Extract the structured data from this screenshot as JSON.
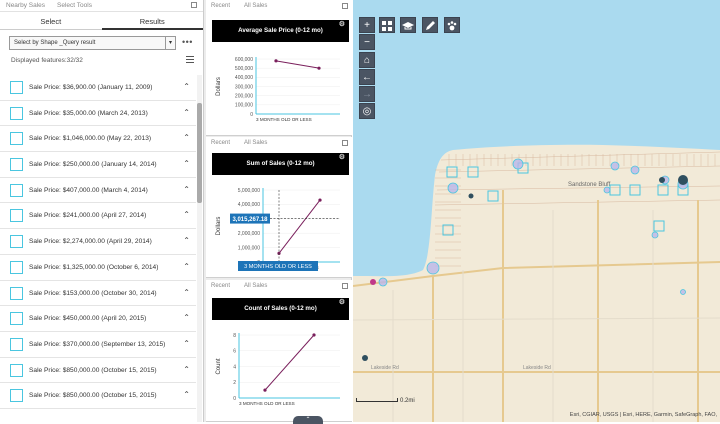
{
  "left_panel": {
    "header_tabs": [
      "Nearby Sales",
      "Select Tools"
    ],
    "tabs": [
      "Select",
      "Results"
    ],
    "select_value": "Select by Shape _Query result",
    "displayed": "Displayed features:32/32",
    "results": [
      "Sale Price: $36,900.00 (January 11, 2009)",
      "Sale Price: $35,000.00 (March 24, 2013)",
      "Sale Price: $1,046,000.00 (May 22, 2013)",
      "Sale Price: $250,000.00 (January 14, 2014)",
      "Sale Price: $407,000.00 (March 4, 2014)",
      "Sale Price: $241,000.00 (April 27, 2014)",
      "Sale Price: $2,274,000.00 (April 29, 2014)",
      "Sale Price: $1,325,000.00 (October 6, 2014)",
      "Sale Price: $153,000.00 (October 30, 2014)",
      "Sale Price: $450,000.00 (April 20, 2015)",
      "Sale Price: $370,000.00 (September 13, 2015)",
      "Sale Price: $850,000.00 (October 15, 2015)",
      "Sale Price: $850,000.00 (October 15, 2015)"
    ]
  },
  "card_tabs": [
    "Recent",
    "All Sales"
  ],
  "chart_data": [
    {
      "type": "line",
      "title": "Average Sale Price (0-12 mo)",
      "ylabel": "Dollars",
      "xlabel": "3 MONTHS OLD OR LESS",
      "yticks": [
        "600,000",
        "500,000",
        "400,000",
        "300,000",
        "200,000",
        "100,000",
        "0"
      ],
      "ylim": [
        0,
        600000
      ],
      "values": [
        580000,
        500000
      ]
    },
    {
      "type": "line",
      "title": "Sum of Sales (0-12 mo)",
      "ylabel": "Dollars",
      "xlabel": "3 MONTHS OLD OR LESS",
      "yticks": [
        "5,000,000",
        "4,000,000",
        "3,000,000",
        "2,000,000",
        "1,000,000",
        "0"
      ],
      "ylim": [
        0,
        5000000
      ],
      "values": [
        600000,
        4300000
      ],
      "tooltip_value": "3,015,267.18",
      "tooltip_x": "3 MONTHS OLD OR LESS"
    },
    {
      "type": "line",
      "title": "Count of Sales (0-12 mo)",
      "ylabel": "Count",
      "xlabel": "3 MONTHS OLD OR LESS",
      "yticks": [
        "8",
        "6",
        "4",
        "2",
        "0"
      ],
      "ylim": [
        0,
        8
      ],
      "values": [
        1,
        8
      ]
    }
  ],
  "map": {
    "attribution": "Esri, CGIAR, USGS | Esri, HERE, Garmin, SafeGraph, FAO,",
    "scale_label": "0.2mi",
    "place_label": "Sandstone Bluff",
    "road_labels": [
      "Lakeside Rd",
      "Lakeside Rd"
    ],
    "colors": {
      "water": "#aadaef",
      "land": "#f2ead8",
      "road": "#e6c98f",
      "marker": "#4ac6e0"
    }
  },
  "toolbar": {
    "zoom_in": "+",
    "zoom_out": "−",
    "home": "⌂",
    "back": "←",
    "forward": "→",
    "locate": "◎"
  },
  "handle_label": "⌃"
}
